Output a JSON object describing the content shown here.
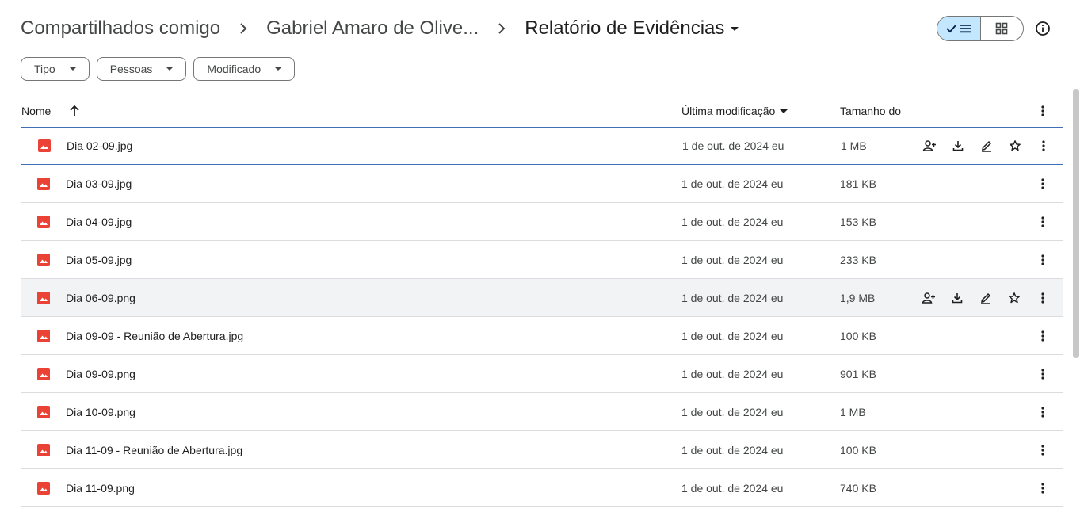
{
  "breadcrumb": {
    "root": "Compartilhados comigo",
    "parent": "Gabriel Amaro de Olive...",
    "current": "Relatório de Evidências"
  },
  "filters": [
    "Tipo",
    "Pessoas",
    "Modificado"
  ],
  "columns": {
    "name": "Nome",
    "modified": "Última modificação",
    "size": "Tamanho do"
  },
  "files": [
    {
      "name": "Dia 02-09.jpg",
      "modified": "1 de out. de 2024 eu",
      "size": "1 MB"
    },
    {
      "name": "Dia 03-09.jpg",
      "modified": "1 de out. de 2024 eu",
      "size": "181 KB"
    },
    {
      "name": "Dia 04-09.jpg",
      "modified": "1 de out. de 2024 eu",
      "size": "153 KB"
    },
    {
      "name": "Dia 05-09.jpg",
      "modified": "1 de out. de 2024 eu",
      "size": "233 KB"
    },
    {
      "name": "Dia 06-09.png",
      "modified": "1 de out. de 2024 eu",
      "size": "1,9 MB"
    },
    {
      "name": "Dia 09-09 - Reunião de Abertura.jpg",
      "modified": "1 de out. de 2024 eu",
      "size": "100 KB"
    },
    {
      "name": "Dia 09-09.png",
      "modified": "1 de out. de 2024 eu",
      "size": "901 KB"
    },
    {
      "name": "Dia 10-09.png",
      "modified": "1 de out. de 2024 eu",
      "size": "1 MB"
    },
    {
      "name": "Dia 11-09 - Reunião de Abertura.jpg",
      "modified": "1 de out. de 2024 eu",
      "size": "100 KB"
    },
    {
      "name": "Dia 11-09.png",
      "modified": "1 de out. de 2024 eu",
      "size": "740 KB"
    }
  ],
  "icons": {
    "file": "image-file-icon",
    "share": "add-person-icon",
    "download": "download-icon",
    "rename": "edit-icon",
    "star": "star-icon",
    "more": "more-vert-icon"
  },
  "colors": {
    "image_icon": "#ea4335",
    "toggle_active": "#c2e7ff",
    "selected_border": "#3e6fb5",
    "hover_row": "#f1f3f4"
  }
}
